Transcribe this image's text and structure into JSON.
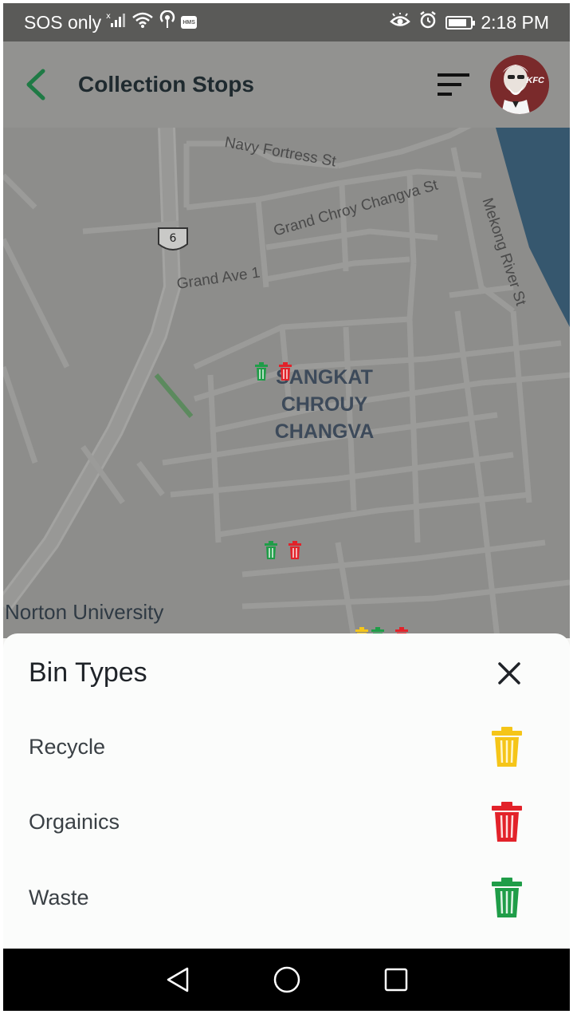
{
  "status_bar": {
    "carrier": "SOS only",
    "time": "2:18 PM",
    "hms_label": "HMS",
    "battery_level": 0.85,
    "icons": [
      "signal-icon",
      "wifi-icon",
      "hotspot-icon",
      "hms-icon",
      "eye-icon",
      "alarm-icon",
      "battery-icon"
    ]
  },
  "app_bar": {
    "title": "Collection Stops",
    "back_icon": "chevron-left-icon",
    "sort_icon": "sort-icon",
    "avatar_brand": "KFC"
  },
  "map": {
    "streets": [
      "Navy Fortress St",
      "Grand Chroy Changva St",
      "Mekong River St",
      "Grand Ave 1"
    ],
    "route_shield": "6",
    "district": [
      "SANGKAT",
      "CHROUY",
      "CHANGVA"
    ],
    "place": "Norton University"
  },
  "sheet": {
    "title": "Bin Types",
    "close_icon": "close-icon",
    "bins": [
      {
        "label": "Recycle",
        "color": "#f5c518"
      },
      {
        "label": "Orgainics",
        "color": "#e2222a"
      },
      {
        "label": "Waste",
        "color": "#1f9d48"
      }
    ]
  },
  "nav_bar": {
    "icons": [
      "back-triangle-icon",
      "home-circle-icon",
      "recents-square-icon"
    ]
  },
  "colors": {
    "accent": "#1f8a4c",
    "recycle": "#f5c518",
    "organics": "#e2222a",
    "waste": "#1f9d48"
  }
}
